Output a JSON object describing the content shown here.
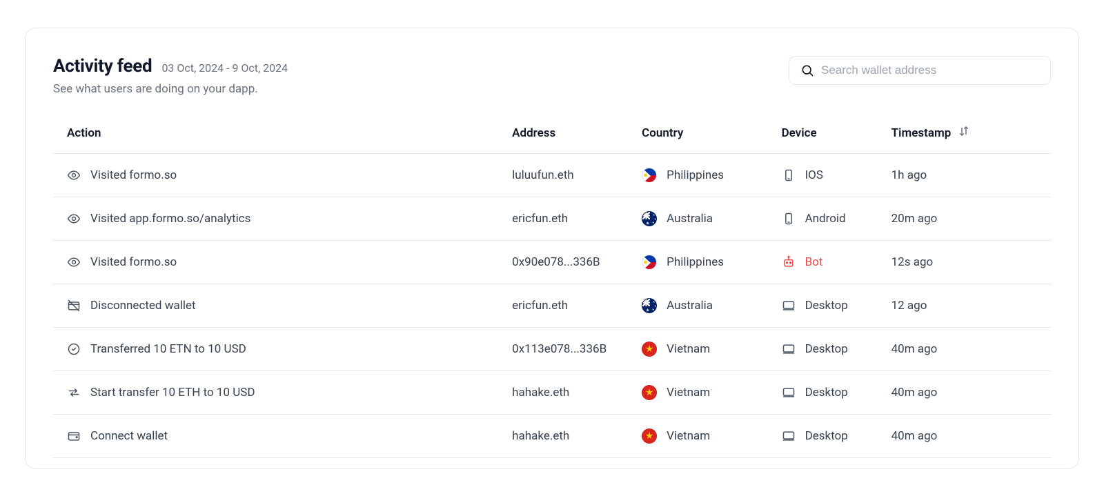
{
  "header": {
    "title": "Activity feed",
    "date_range": "03 Oct, 2024 - 9 Oct, 2024",
    "subtitle": "See what users are doing on your dapp."
  },
  "search": {
    "placeholder": "Search wallet address",
    "value": ""
  },
  "table": {
    "columns": {
      "action": "Action",
      "address": "Address",
      "country": "Country",
      "device": "Device",
      "timestamp": "Timestamp"
    },
    "rows": [
      {
        "action_icon": "eye",
        "action": "Visited formo.so",
        "address": "luluufun.eth",
        "country": "Philippines",
        "country_code": "ph",
        "device_icon": "mobile",
        "device": "IOS",
        "device_color": "default",
        "timestamp": "1h ago"
      },
      {
        "action_icon": "eye",
        "action": "Visited app.formo.so/analytics",
        "address": "ericfun.eth",
        "country": "Australia",
        "country_code": "au",
        "device_icon": "mobile",
        "device": "Android",
        "device_color": "default",
        "timestamp": "20m ago"
      },
      {
        "action_icon": "eye",
        "action": "Visited formo.so",
        "address": "0x90e078...336B",
        "country": "Philippines",
        "country_code": "ph",
        "device_icon": "bot",
        "device": "Bot",
        "device_color": "bot",
        "timestamp": "12s ago"
      },
      {
        "action_icon": "wallet-off",
        "action": "Disconnected wallet",
        "address": "ericfun.eth",
        "country": "Australia",
        "country_code": "au",
        "device_icon": "desktop",
        "device": "Desktop",
        "device_color": "default",
        "timestamp": "12 ago"
      },
      {
        "action_icon": "check-circle",
        "action": "Transferred 10 ETN to 10 USD",
        "address": "0x113e078...336B",
        "country": "Vietnam",
        "country_code": "vn",
        "device_icon": "desktop",
        "device": "Desktop",
        "device_color": "default",
        "timestamp": "40m ago"
      },
      {
        "action_icon": "swap",
        "action": "Start transfer 10 ETH to 10 USD",
        "address": "hahake.eth",
        "country": "Vietnam",
        "country_code": "vn",
        "device_icon": "desktop",
        "device": "Desktop",
        "device_color": "default",
        "timestamp": "40m ago"
      },
      {
        "action_icon": "wallet",
        "action": "Connect wallet",
        "address": "hahake.eth",
        "country": "Vietnam",
        "country_code": "vn",
        "device_icon": "desktop",
        "device": "Desktop",
        "device_color": "default",
        "timestamp": "40m ago"
      }
    ]
  }
}
